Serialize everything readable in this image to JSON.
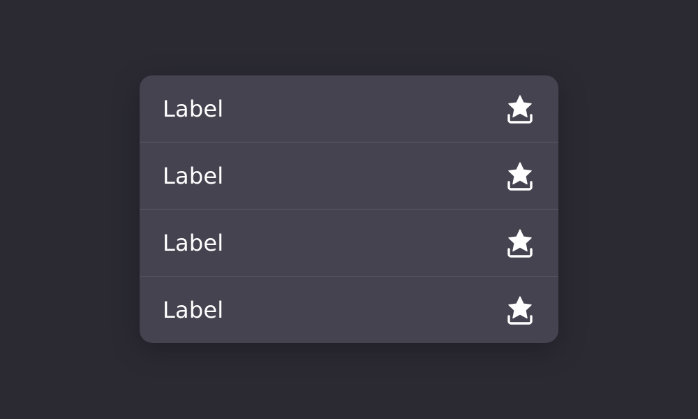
{
  "menu": {
    "items": [
      {
        "label": "Label",
        "icon": "star-tray-icon"
      },
      {
        "label": "Label",
        "icon": "star-tray-icon"
      },
      {
        "label": "Label",
        "icon": "star-tray-icon"
      },
      {
        "label": "Label",
        "icon": "star-tray-icon"
      }
    ]
  },
  "colors": {
    "background": "#2b2a33",
    "menu_background": "#45434f",
    "divider": "#5d5a67",
    "text": "#ffffff"
  }
}
